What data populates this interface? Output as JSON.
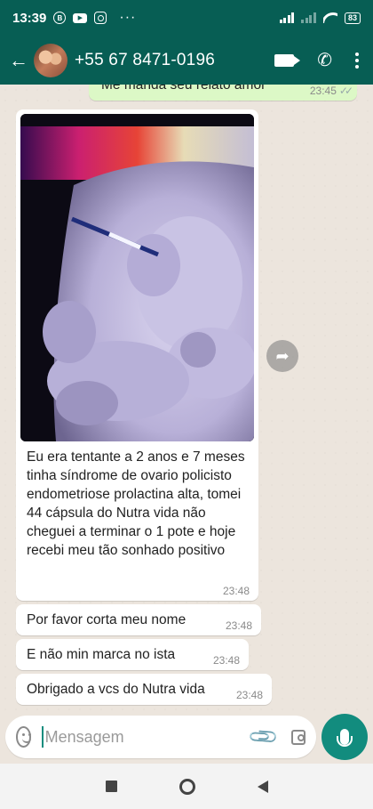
{
  "status_bar": {
    "time": "13:39",
    "battery": "83",
    "app_icons": [
      "b-icon",
      "youtube-icon",
      "instagram-icon"
    ]
  },
  "header": {
    "contact_name": "+55 67 8471-0196"
  },
  "messages": [
    {
      "direction": "outgoing",
      "text": "Me manda seu relato amor",
      "time": "23:45",
      "read": true
    },
    {
      "direction": "incoming",
      "type": "image",
      "text": "Eu era tentante a 2 anos e 7 meses tinha síndrome de ovario policisto endometriose prolactina alta, tomei 44 cápsula do Nutra vida não cheguei a terminar o 1 pote e hoje recebi meu tão sonhado positivo",
      "time": "23:48"
    },
    {
      "direction": "incoming",
      "text": "Por favor corta meu nome",
      "time": "23:48"
    },
    {
      "direction": "incoming",
      "text": "E não min marca no ista",
      "time": "23:48"
    },
    {
      "direction": "incoming",
      "text": "Obrigado a vcs do Nutra vida",
      "time": "23:48"
    }
  ],
  "input": {
    "placeholder": "Mensagem",
    "value": ""
  },
  "colors": {
    "header": "#075e54",
    "outgoing_bubble": "#dcf8c6",
    "accent": "#128c7e",
    "chat_bg": "#ece5dd"
  }
}
